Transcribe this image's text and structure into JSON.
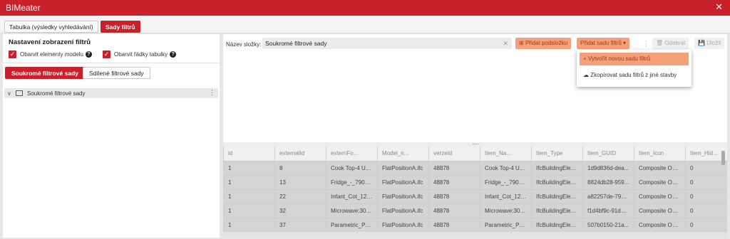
{
  "app": {
    "title": "BIMeater"
  },
  "tabs": [
    {
      "label": "Tabulka (výsledky vyhledávání)"
    },
    {
      "label": "Sady filtrů"
    }
  ],
  "left": {
    "heading": "Nastavení zobrazení filtrů",
    "checkboxes": [
      {
        "label": "Obarvit elementy modelu",
        "checked": true
      },
      {
        "label": "Obarvit řádky tabulky",
        "checked": true
      }
    ],
    "subtabs": [
      {
        "label": "Soukromé filtrové sady"
      },
      {
        "label": "Sdílené filtrové sady"
      }
    ],
    "tree": [
      {
        "label": "Soukromé filtrové sady"
      }
    ]
  },
  "right": {
    "field_label": "Název složky:",
    "field_value": "Soukromé filtrové sady",
    "buttons": {
      "add_subfolder": "Přidat podsložku",
      "add_set": "Přidat sadu filtrů",
      "delete": "Odebrat",
      "save": "Uložit"
    },
    "dropdown": [
      {
        "label": "Vytvořit novou sadu filtrů",
        "icon": "plus-icon"
      },
      {
        "label": "Zkopírovat sadu filtrů z jiné stavby",
        "icon": "cloud-download-icon"
      }
    ]
  },
  "grid": {
    "columns": [
      "id",
      "externalId",
      "externFo...",
      "Model_n...",
      "verzeId",
      "Item_Na...",
      "Item_Type",
      "Item_GUID",
      "Item_Icon",
      "Item_Hid..."
    ],
    "rows": [
      [
        "1",
        "8",
        "Cook Top-4 Uni...",
        "FlatPositionA.ifc",
        "48878",
        "Cook Top-4 Uni...",
        "IfcBuildingElem...",
        "1d9d836d-dea...",
        "Composite Obj...",
        "0"
      ],
      [
        "1",
        "13",
        "Fridge_-_790W...",
        "FlatPositionA.ifc",
        "48878",
        "Fridge_-_790W...",
        "IfcBuildingElem...",
        "8824db28-959...",
        "Composite Obj...",
        "0"
      ],
      [
        "1",
        "22",
        "Infant_Cot_121...",
        "FlatPositionA.ifc",
        "48878",
        "Infant_Cot_121...",
        "IfcBuildingElem...",
        "a82257de-79c9...",
        "Composite Obj...",
        "0"
      ],
      [
        "1",
        "32",
        "Microwave:30\" ...",
        "FlatPositionA.ifc",
        "48878",
        "Microwave:30\" ...",
        "IfcBuildingElem...",
        "f1d4bf9c-91d5-...",
        "Composite Obj...",
        "0"
      ],
      [
        "1",
        "37",
        "Parametric_Por...",
        "FlatPositionA.ifc",
        "48878",
        "Parametric_Por...",
        "IfcBuildingElem...",
        "507b0150-21a...",
        "Composite Obj...",
        "0"
      ]
    ]
  }
}
